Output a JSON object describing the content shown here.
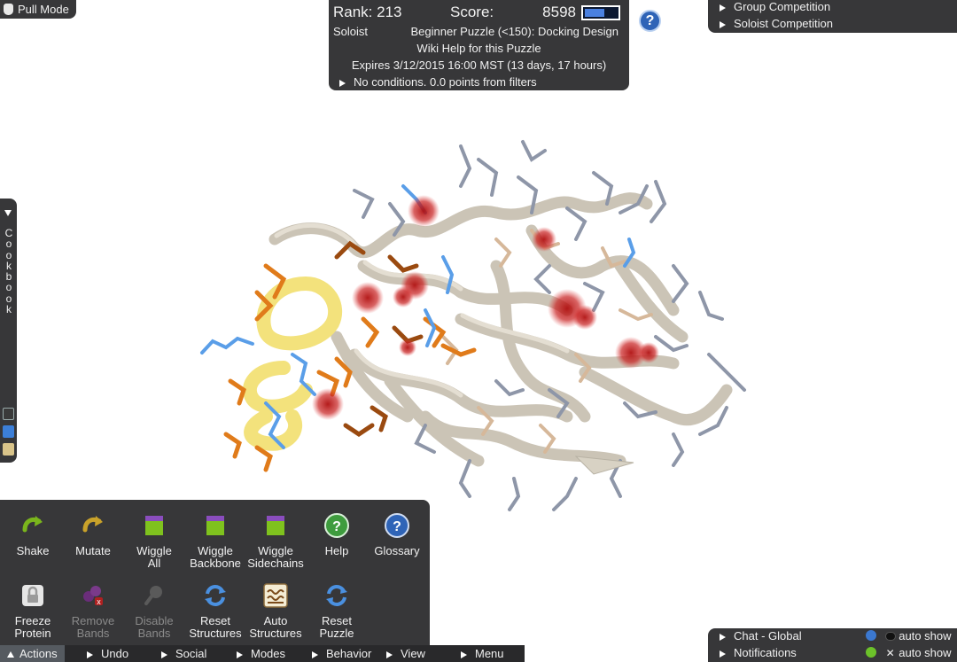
{
  "pull_mode": {
    "label": "Pull Mode"
  },
  "score_panel": {
    "rank": "Rank: 213",
    "score_label": "Score:",
    "score_value": "8598",
    "score_meter_fill": 0.6,
    "player_mode": "Soloist",
    "puzzle_type": "Beginner Puzzle (<150): Docking Design",
    "wiki": "Wiki Help for this Puzzle",
    "expires": "Expires 3/12/2015 16:00 MST (13 days, 17 hours)",
    "conditions": "No conditions. 0.0 points from filters"
  },
  "help_button": {
    "glyph": "?"
  },
  "competitions": [
    "Group Competition",
    "Soloist Competition"
  ],
  "cookbook": {
    "letters": [
      "C",
      "o",
      "o",
      "k",
      "b",
      "o",
      "o",
      "k"
    ]
  },
  "actions": [
    {
      "line1": "Shake",
      "line2": "",
      "icon": "shake-icon"
    },
    {
      "line1": "Mutate",
      "line2": "",
      "icon": "mutate-icon"
    },
    {
      "line1": "Wiggle",
      "line2": "All",
      "icon": "wiggle-all-icon"
    },
    {
      "line1": "Wiggle",
      "line2": "Backbone",
      "icon": "wiggle-backbone-icon"
    },
    {
      "line1": "Wiggle",
      "line2": "Sidechains",
      "icon": "wiggle-sidechains-icon"
    },
    {
      "line1": "Help",
      "line2": "",
      "icon": "help-icon"
    },
    {
      "line1": "Glossary",
      "line2": "",
      "icon": "glossary-icon"
    },
    {
      "line1": "Freeze",
      "line2": "Protein",
      "icon": "lock-icon"
    },
    {
      "line1": "Remove",
      "line2": "Bands",
      "icon": "remove-bands-icon"
    },
    {
      "line1": "Disable",
      "line2": "Bands",
      "icon": "disable-bands-icon"
    },
    {
      "line1": "Reset",
      "line2": "Structures",
      "icon": "reset-structures-icon"
    },
    {
      "line1": "Auto",
      "line2": "Structures",
      "icon": "auto-structures-icon"
    },
    {
      "line1": "Reset",
      "line2": "Puzzle",
      "icon": "reset-puzzle-icon"
    }
  ],
  "bottom_bar": [
    "Actions",
    "Undo",
    "Social",
    "Modes",
    "Behavior",
    "View",
    "Menu"
  ],
  "chat": {
    "items": [
      "Chat - Global",
      "Notifications"
    ],
    "auto_show": [
      "auto show",
      "auto show"
    ]
  },
  "colors": {
    "panel": "#262628",
    "backbone": "#c9c2b4",
    "sidechain_orange": "#e07b1a",
    "sidechain_blue": "#5a9ee8",
    "helix_yellow": "#f2e27a",
    "clash_red": "#c81e1e"
  }
}
